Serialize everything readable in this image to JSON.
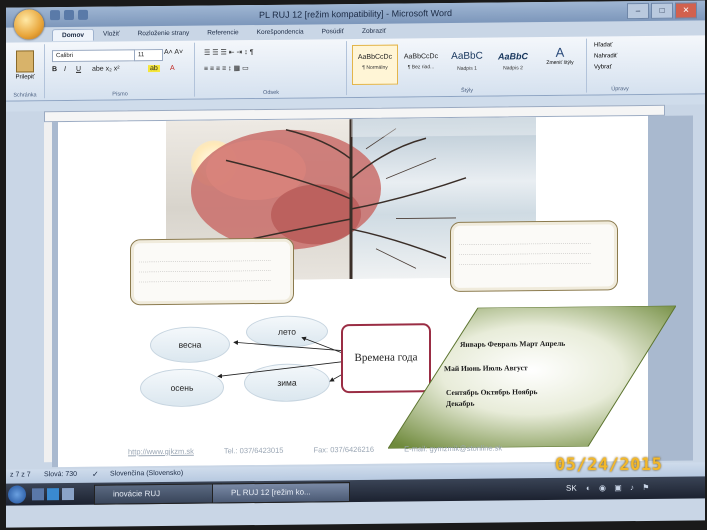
{
  "window": {
    "title": "PL RUJ 12 [režim kompatibility] - Microsoft Word"
  },
  "tabs": [
    "Domov",
    "Vložiť",
    "Rozloženie strany",
    "Referencie",
    "Korešpondencia",
    "Posúdiť",
    "Zobraziť"
  ],
  "ribbon": {
    "clipboard": {
      "paste_label": "Prilepiť",
      "group_label": "Schránka"
    },
    "font": {
      "name": "Calibri",
      "size": "11",
      "group_label": "Písmo"
    },
    "paragraph": {
      "group_label": "Odsek"
    },
    "styles": {
      "items": [
        {
          "preview": "AaBbCcDc",
          "name": "¶ Normálny"
        },
        {
          "preview": "AaBbCcDc",
          "name": "¶ Bez riad..."
        },
        {
          "preview": "AaBbC",
          "name": "Nadpis 1"
        },
        {
          "preview": "AaBbC",
          "name": "Nadpis 2"
        }
      ],
      "change_label": "Zmeniť štýly",
      "group_label": "Štýly"
    },
    "editing": {
      "find": "Hľadať",
      "replace": "Nahradiť",
      "select": "Vybrať",
      "group_label": "Úpravy"
    }
  },
  "document": {
    "left_box_lines": [
      "......................................................................",
      "......................................................................",
      "......................................................................"
    ],
    "right_box_lines": [
      "......................................................................",
      "......................................................................",
      "......................................................................"
    ],
    "seasons": {
      "spring": "весна",
      "summer": "лето",
      "autumn": "осень",
      "winter": "зима"
    },
    "center_label": "Времена года",
    "months": [
      "Январь Февраль Март Апрель",
      "Май Июнь Июль Август",
      "Сентябрь Октябрь Ноябрь",
      "Декабрь"
    ],
    "footer": {
      "url": "http://www.gjkzm.sk",
      "tel": "Tel.: 037/6423015",
      "fax": "Fax: 037/6426216",
      "email": "E-mail: gymzmik@stonline.sk"
    }
  },
  "status": {
    "page": "z 7 z 7",
    "words": "Slová: 730",
    "language": "Slovenčina (Slovensko)"
  },
  "taskbar": {
    "items": [
      "inovácie RUJ",
      "PL RUJ 12 [režim ko..."
    ],
    "clock_hint": "SK"
  },
  "timestamp": "05/24/2015"
}
